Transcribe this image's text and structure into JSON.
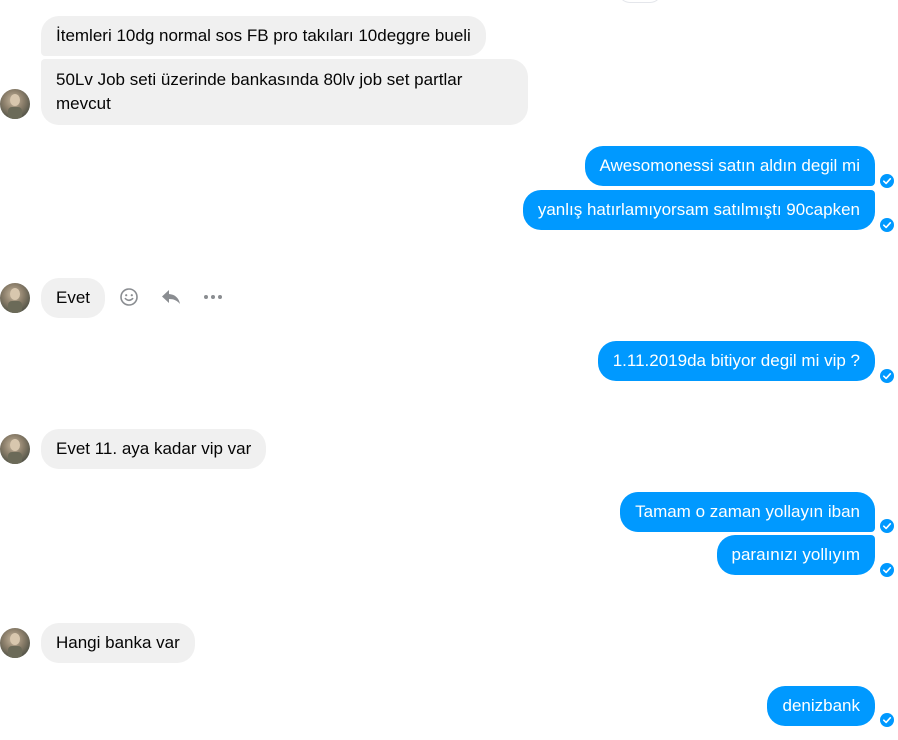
{
  "messages": [
    {
      "id": "m1",
      "direction": "incoming",
      "text": "İtemleri 10dg normal sos FB pro takıları 10deggre bueli"
    },
    {
      "id": "m2",
      "direction": "incoming",
      "text": "50Lv Job seti üzerinde bankasında 80lv job set partlar mevcut"
    },
    {
      "id": "m3",
      "direction": "outgoing",
      "text": "Awesomonessi satın aldın degil mi",
      "status": "delivered"
    },
    {
      "id": "m4",
      "direction": "outgoing",
      "text": "yanlış hatırlamıyorsam satılmıştı 90capken",
      "status": "delivered"
    },
    {
      "id": "m5",
      "direction": "incoming",
      "text": "Evet"
    },
    {
      "id": "m6",
      "direction": "outgoing",
      "text": "1.11.2019da bitiyor degil mi vip ?",
      "status": "delivered"
    },
    {
      "id": "m7",
      "direction": "incoming",
      "text": "Evet 11. aya kadar vip var"
    },
    {
      "id": "m8",
      "direction": "outgoing",
      "text": "Tamam o zaman yollayın iban",
      "status": "delivered"
    },
    {
      "id": "m9",
      "direction": "outgoing",
      "text": "paraınızı yollıyım",
      "status": "delivered"
    },
    {
      "id": "m10",
      "direction": "incoming",
      "text": "Hangi banka var"
    },
    {
      "id": "m11",
      "direction": "outgoing",
      "text": "denizbank",
      "status": "delivered"
    }
  ],
  "hover_actions": {
    "icons": [
      "smiley-icon",
      "reply-icon",
      "more-icon"
    ]
  },
  "colors": {
    "incoming_bubble": "#f0f0f0",
    "outgoing_bubble": "#0099ff",
    "delivered_check": "#0099ff",
    "action_icon": "#8a8d91"
  }
}
